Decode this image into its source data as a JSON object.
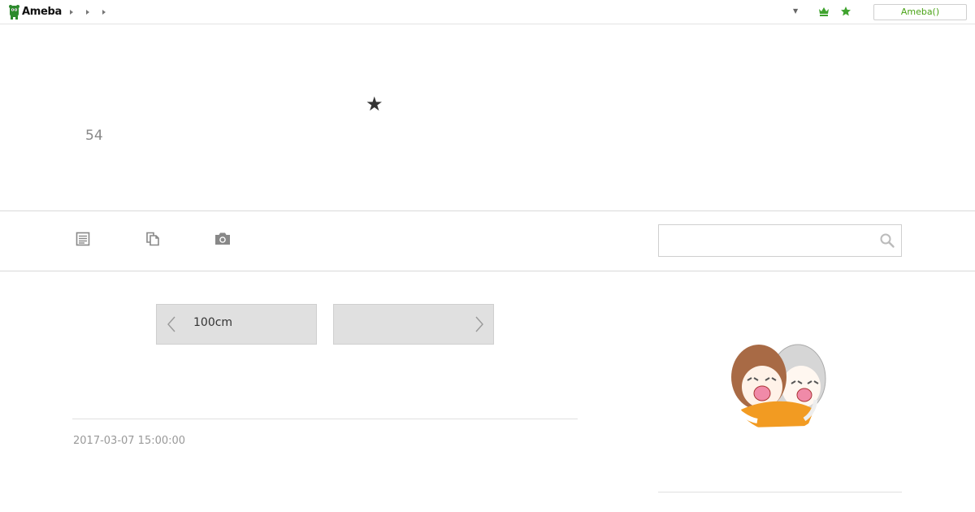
{
  "topbar": {
    "logo_text": "Ameba",
    "breadcrumbs": [
      "",
      "",
      ""
    ],
    "login_label": "Ameba()",
    "accent_color": "#4aa316"
  },
  "header": {
    "title_star": "★",
    "age_text": "54"
  },
  "nav": {
    "items": [
      "document-icon",
      "copy-icon",
      "camera-icon"
    ],
    "search": {
      "value": "",
      "placeholder": ""
    }
  },
  "pager": {
    "prev_label": "100cm",
    "next_label": ""
  },
  "post": {
    "date": "2017-03-07 15:00:00"
  },
  "sidebar": {
    "avatar": "profile-illustration"
  }
}
